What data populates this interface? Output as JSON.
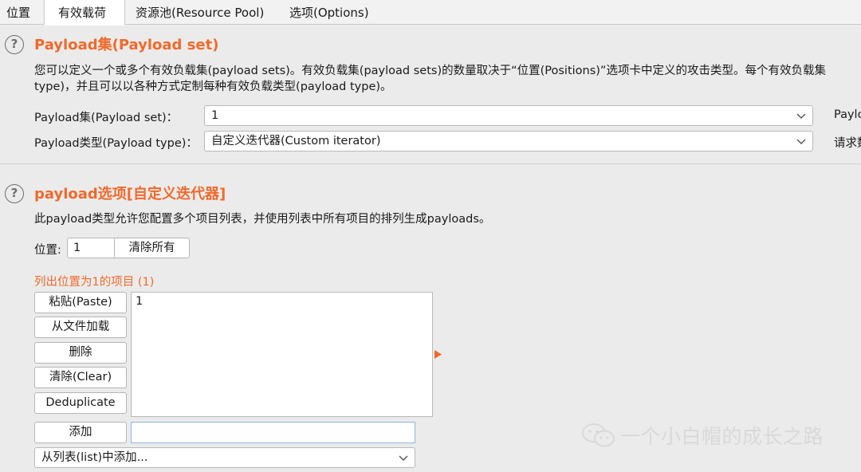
{
  "tabs": {
    "positions": "位置",
    "payloads": "有效载荷",
    "resource_pool": "资源池(Resource Pool)",
    "options": "选项(Options)"
  },
  "payload_sets": {
    "title": "Payload集(Payload set)",
    "desc_line1": "您可以定义一个或多个有效负载集(payload sets)。有效负载集(payload sets)的数量取决于“位置(Positions)”选项卡中定义的攻击类型。每个有效负载集",
    "desc_line2": "type)，并且可以以各种方式定制每种有效负载类型(payload type)。",
    "set_label": "Payload集(Payload set)：",
    "set_value": "1",
    "type_label": "Payload类型(Payload type)：",
    "type_value": "自定义迭代器(Custom iterator)",
    "side_label_1": "Paylo",
    "side_label_2": "请求数"
  },
  "payload_options": {
    "title": "payload选项[自定义迭代器]",
    "description": "此payload类型允许您配置多个项目列表，并使用列表中所有项目的排列生成payloads。",
    "position_label": "位置:",
    "position_value": "1",
    "clear_all": "清除所有",
    "list_heading": "列出位置为1的项目 (1)",
    "buttons": {
      "paste": "粘贴(Paste)",
      "load": "从文件加载",
      "remove": "删除",
      "clear": "清除(Clear)",
      "deduplicate": "Deduplicate",
      "add": "添加"
    },
    "list_items": [
      "1"
    ],
    "add_input_value": "",
    "add_from_list": "从列表(list)中添加..."
  },
  "watermark": "一个小白帽的成长之路",
  "colors": {
    "accent": "#f06a2c",
    "background": "#ebebeb",
    "focus_border": "#8ab4e8"
  },
  "icons": {
    "help": "question-circle-icon",
    "dropdown": "chevron-down-icon",
    "expand": "triangle-right-icon",
    "watermark": "wechat-icon"
  }
}
